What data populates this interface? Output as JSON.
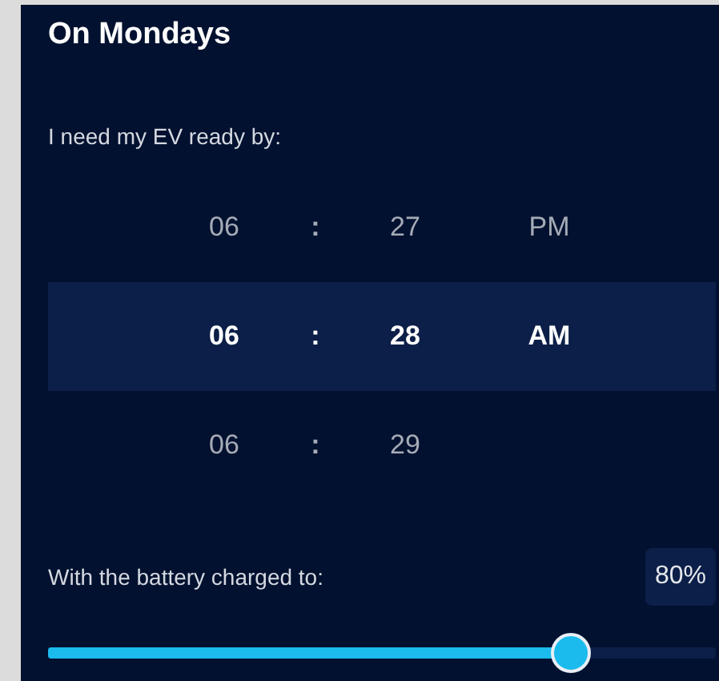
{
  "title": "On Mondays",
  "time_label": "I need my EV ready by:",
  "time_rows": [
    {
      "hour": "06",
      "separator": ":",
      "minute": "27",
      "period": "PM",
      "selected": false
    },
    {
      "hour": "06",
      "separator": ":",
      "minute": "28",
      "period": "AM",
      "selected": true
    },
    {
      "hour": "06",
      "separator": ":",
      "minute": "29",
      "selected": false
    }
  ],
  "battery": {
    "label": "With the battery charged to:",
    "reading": "80%",
    "level": 0.8
  }
}
